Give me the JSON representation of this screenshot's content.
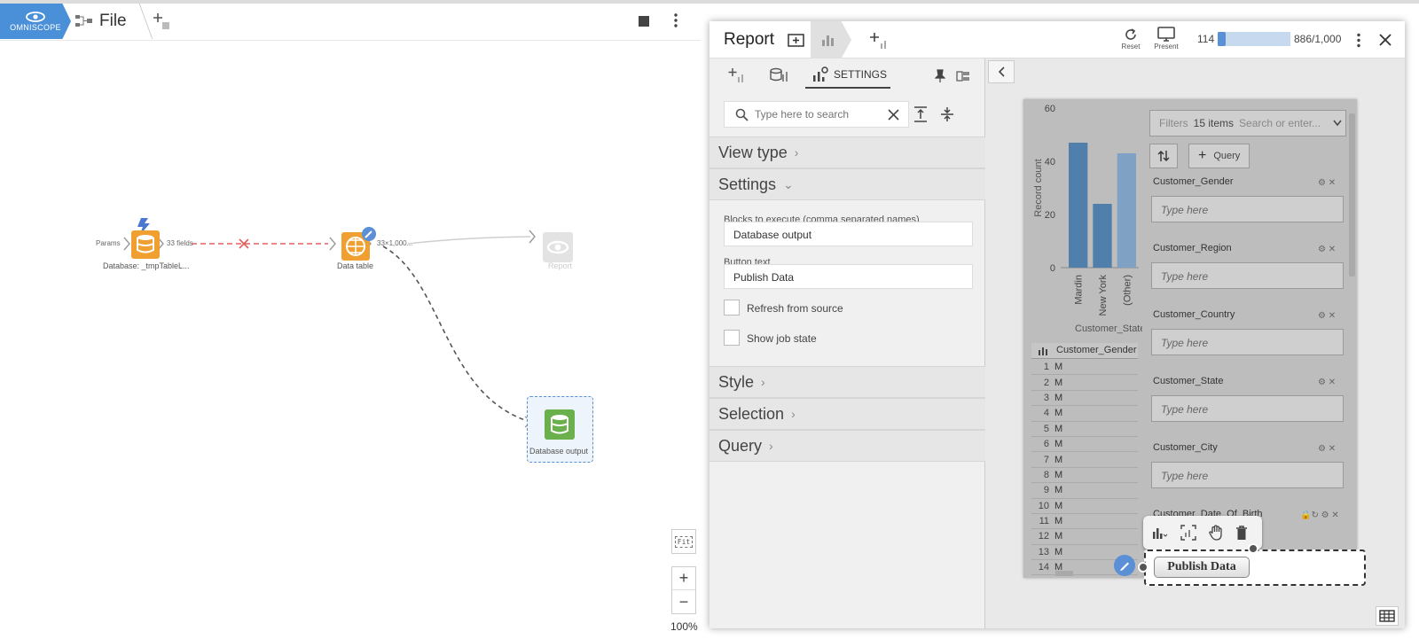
{
  "app": {
    "logo_text": "OMNISCOPE",
    "breadcrumb": "File"
  },
  "workflow": {
    "nodes": [
      {
        "label": "Database: _tmpTableL..."
      },
      {
        "label": "Data table"
      },
      {
        "label": "Report"
      },
      {
        "label": "Database output"
      }
    ],
    "edges": {
      "params": "Params",
      "fields": "33 fields",
      "size": "33×1,000..."
    },
    "zoom": "100%",
    "fit": "Fit"
  },
  "report": {
    "title": "Report",
    "reset": "Reset",
    "present": "Present",
    "range_start": "114",
    "range_end": "886/1,000",
    "range_selected_fraction": [
      0.114,
      0.886
    ],
    "settings_tab": "SETTINGS",
    "search_placeholder": "Type here to search",
    "sections": {
      "view_type": "View type",
      "settings": "Settings",
      "style": "Style",
      "selection": "Selection",
      "query": "Query"
    },
    "fields": {
      "blocks_label": "Blocks to execute (comma separated names)",
      "blocks_value": "Database output",
      "button_text_label": "Button text",
      "button_text_value": "Publish Data",
      "refresh_label": "Refresh from source",
      "show_job_label": "Show job state"
    }
  },
  "preview": {
    "filters_label": "Filters",
    "filters_count": "15 items",
    "filters_placeholder": "Search or enter...",
    "query_label": "Query",
    "field_placeholder": "Type here",
    "filter_fields": [
      "Customer_Gender",
      "Customer_Region",
      "Customer_Country",
      "Customer_State",
      "Customer_City",
      "Customer_Date_Of_Birth"
    ],
    "publish_button": "Publish Data",
    "table_header": "Customer_Gender",
    "table_rows": [
      {
        "n": "1",
        "v": "M"
      },
      {
        "n": "2",
        "v": "M"
      },
      {
        "n": "3",
        "v": "M"
      },
      {
        "n": "4",
        "v": "M"
      },
      {
        "n": "5",
        "v": "M"
      },
      {
        "n": "6",
        "v": "M"
      },
      {
        "n": "7",
        "v": "M"
      },
      {
        "n": "8",
        "v": "M"
      },
      {
        "n": "9",
        "v": "M"
      },
      {
        "n": "10",
        "v": "M"
      },
      {
        "n": "11",
        "v": "M"
      },
      {
        "n": "12",
        "v": "M"
      },
      {
        "n": "13",
        "v": "M"
      },
      {
        "n": "14",
        "v": "M"
      }
    ]
  },
  "chart_data": {
    "type": "bar",
    "categories": [
      "Mardin",
      "New York",
      "(Other)"
    ],
    "values": [
      47,
      24,
      43
    ],
    "xlabel": "Customer_State",
    "ylabel": "Record count",
    "ylim": [
      0,
      60
    ],
    "yticks": [
      "0",
      "20",
      "40",
      "60"
    ],
    "colors": [
      "#4f7faa",
      "#4f7faa",
      "#7fa1c4"
    ]
  },
  "colors": {
    "accent": "#4a90d9",
    "node_orange": "#f0a030",
    "node_green": "#6ab04c",
    "edge_red": "#e05050"
  }
}
